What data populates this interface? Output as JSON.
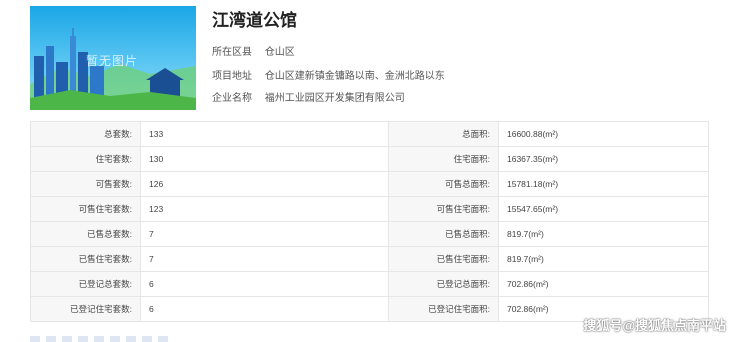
{
  "project": {
    "name": "江湾道公馆",
    "thumbnail_text": "暂无图片",
    "details": [
      {
        "label": "所在区县",
        "value": "仓山区"
      },
      {
        "label": "项目地址",
        "value": "仓山区建新镇金镛路以南、金洲北路以东"
      },
      {
        "label": "企业名称",
        "value": "福州工业园区开发集团有限公司"
      }
    ]
  },
  "table": {
    "rows": [
      {
        "left_label": "总套数:",
        "left_value": "133",
        "right_label": "总面积:",
        "right_value": "16600.88(m²)"
      },
      {
        "left_label": "住宅套数:",
        "left_value": "130",
        "right_label": "住宅面积:",
        "right_value": "16367.35(m²)"
      },
      {
        "left_label": "可售套数:",
        "left_value": "126",
        "right_label": "可售总面积:",
        "right_value": "15781.18(m²)"
      },
      {
        "left_label": "可售住宅套数:",
        "left_value": "123",
        "right_label": "可售住宅面积:",
        "right_value": "15547.65(m²)"
      },
      {
        "left_label": "已售总套数:",
        "left_value": "7",
        "right_label": "已售总面积:",
        "right_value": "819.7(m²)"
      },
      {
        "left_label": "已售住宅套数:",
        "left_value": "7",
        "right_label": "已售住宅面积:",
        "right_value": "819.7(m²)"
      },
      {
        "left_label": "已登记总套数:",
        "left_value": "6",
        "right_label": "已登记总面积:",
        "right_value": "702.86(m²)"
      },
      {
        "left_label": "已登记住宅套数:",
        "left_value": "6",
        "right_label": "已登记住宅面积:",
        "right_value": "702.86(m²)"
      }
    ]
  },
  "watermark": "搜狐号@搜狐焦点南平站",
  "colors": {
    "sky": "#1aa6e6",
    "skyline": "#1f5fae",
    "grass": "#4cb648",
    "label_bg": "#f7f7f7",
    "border": "#e6e6e6"
  }
}
